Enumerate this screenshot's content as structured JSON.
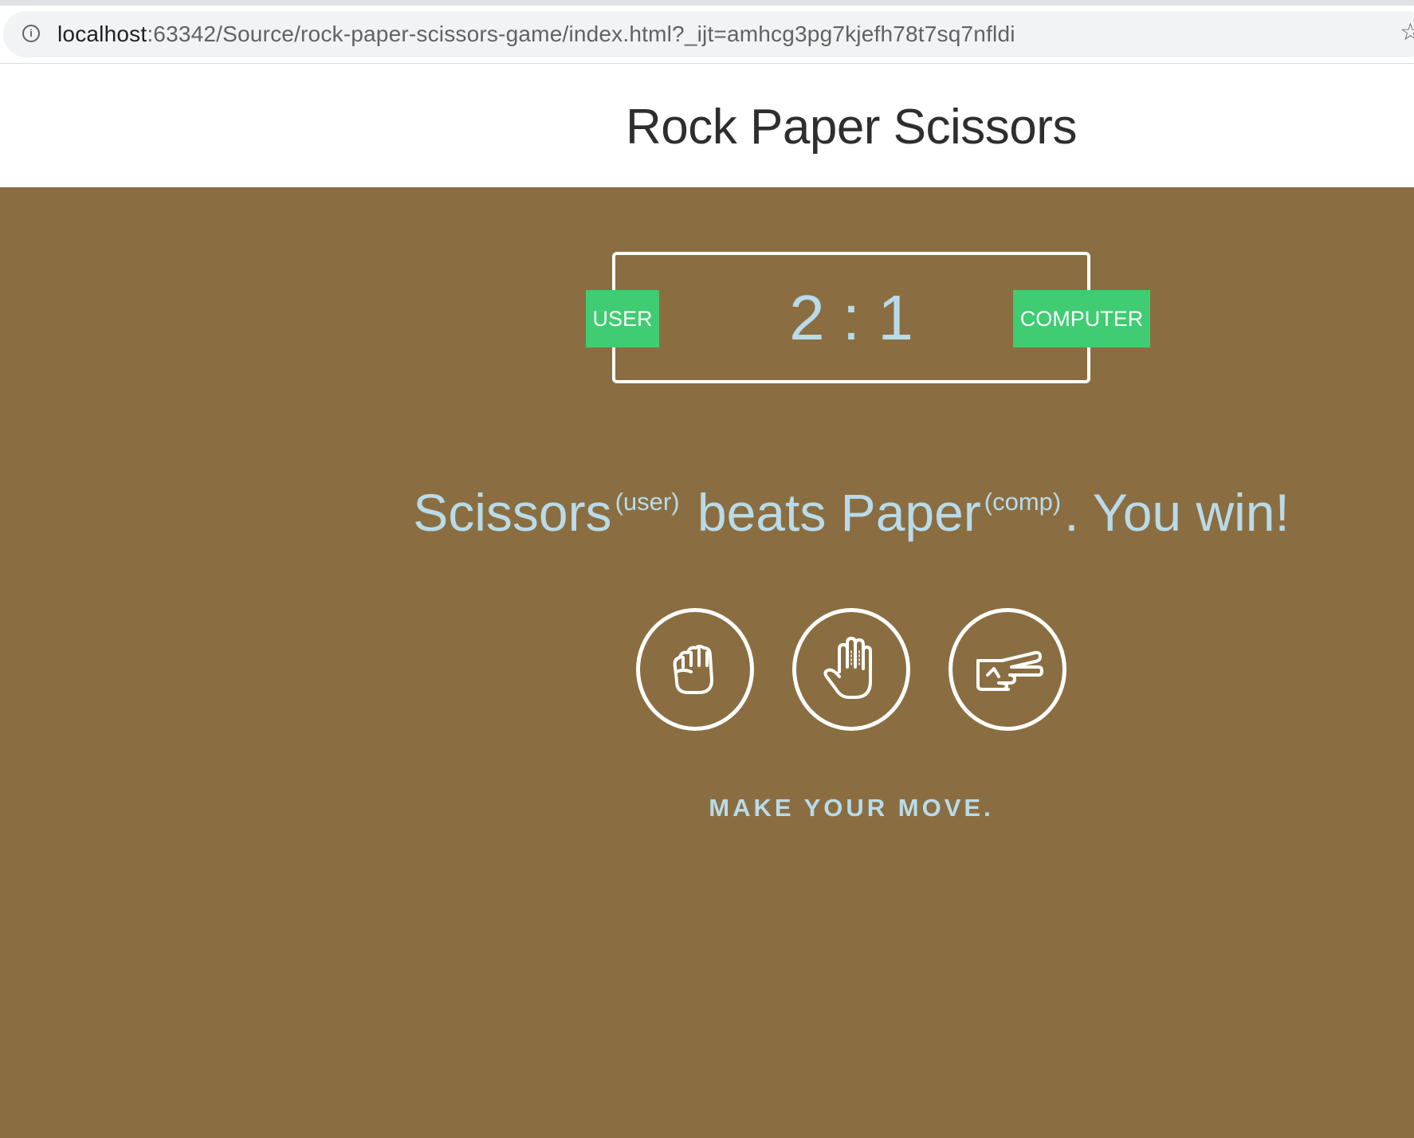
{
  "browser": {
    "url_host": "localhost",
    "url_rest": ":63342/Source/rock-paper-scissors-game/index.html?_ijt=amhcg3pg7kjefh78t7sq7nfldi",
    "info_icon": "i",
    "star_icon": "☆"
  },
  "header": {
    "title": "Rock Paper Scissors"
  },
  "scoreboard": {
    "user_label": "USER",
    "computer_label": "COMPUTER",
    "score": "2 : 1"
  },
  "result": {
    "user_choice": "Scissors",
    "user_tag": "(user)",
    "verb": "beats",
    "comp_choice": "Paper",
    "comp_tag": "(comp)",
    "outcome": ". You win!"
  },
  "choices": [
    {
      "name": "rock",
      "icon": "fist-icon"
    },
    {
      "name": "paper",
      "icon": "open-hand-icon"
    },
    {
      "name": "scissors",
      "icon": "victory-hand-icon"
    }
  ],
  "prompt": "MAKE YOUR MOVE.",
  "colors": {
    "background": "#8a6e41",
    "badge": "#3fcc72",
    "text_accent": "#b9dbe9"
  }
}
